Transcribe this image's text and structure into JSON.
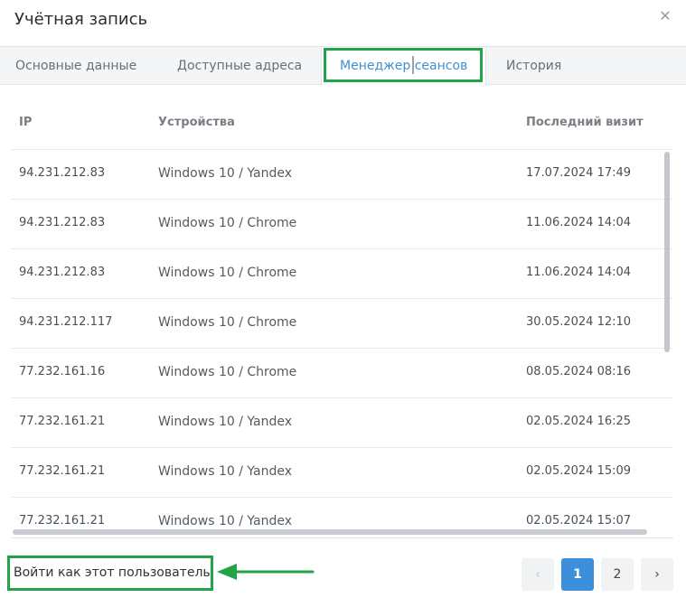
{
  "dialog": {
    "title": "Учётная запись",
    "close_glyph": "✕"
  },
  "tabs": [
    {
      "label": "Основные данные",
      "active": false
    },
    {
      "label": "Доступные адреса",
      "active": false
    },
    {
      "label": "Менеджер сеансов",
      "active": true
    },
    {
      "label": "История",
      "active": false
    }
  ],
  "table": {
    "columns": [
      "IP",
      "Устройства",
      "Последний визит"
    ],
    "rows": [
      {
        "ip": "94.231.212.83",
        "device": "Windows 10 / Yandex",
        "last_visit": "17.07.2024 17:49"
      },
      {
        "ip": "94.231.212.83",
        "device": "Windows 10 / Chrome",
        "last_visit": "11.06.2024 14:04"
      },
      {
        "ip": "94.231.212.83",
        "device": "Windows 10 / Chrome",
        "last_visit": "11.06.2024 14:04"
      },
      {
        "ip": "94.231.212.117",
        "device": "Windows 10 / Chrome",
        "last_visit": "30.05.2024 12:10"
      },
      {
        "ip": "77.232.161.16",
        "device": "Windows 10 / Chrome",
        "last_visit": "08.05.2024 08:16"
      },
      {
        "ip": "77.232.161.21",
        "device": "Windows 10 / Yandex",
        "last_visit": "02.05.2024 16:25"
      },
      {
        "ip": "77.232.161.21",
        "device": "Windows 10 / Yandex",
        "last_visit": "02.05.2024 15:09"
      },
      {
        "ip": "77.232.161.21",
        "device": "Windows 10 / Yandex",
        "last_visit": "02.05.2024 15:07"
      }
    ]
  },
  "footer": {
    "login_as_label": "Войти как этот пользователь",
    "pagination": {
      "prev_glyph": "‹",
      "next_glyph": "›",
      "pages": [
        "1",
        "2"
      ],
      "current": "1"
    }
  },
  "colors": {
    "accent": "#3d8fdd",
    "highlight": "#22a347"
  }
}
